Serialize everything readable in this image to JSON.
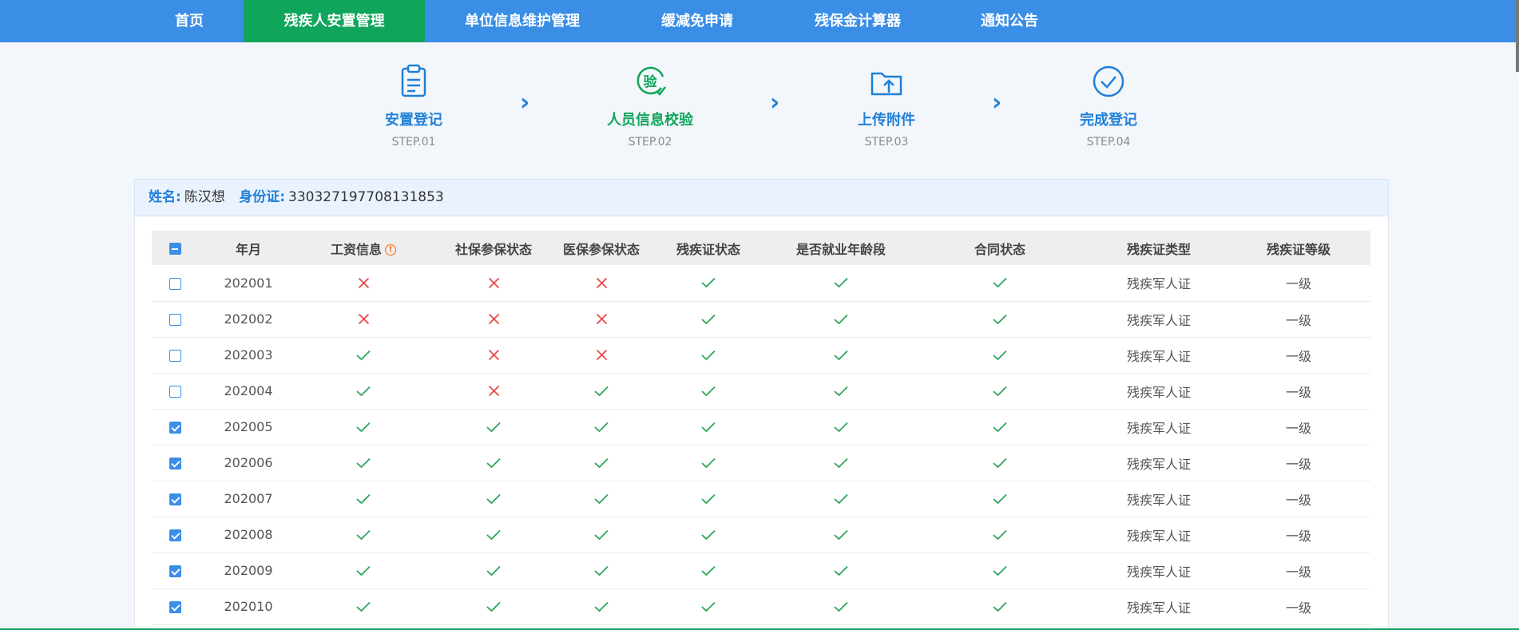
{
  "nav": {
    "items": [
      {
        "label": "首页",
        "active": false
      },
      {
        "label": "残疾人安置管理",
        "active": true
      },
      {
        "label": "单位信息维护管理",
        "active": false
      },
      {
        "label": "缓减免申请",
        "active": false
      },
      {
        "label": "残保金计算器",
        "active": false
      },
      {
        "label": "通知公告",
        "active": false
      }
    ]
  },
  "steps": [
    {
      "label": "安置登记",
      "sub": "STEP.01",
      "icon": "clipboard-icon",
      "current": false
    },
    {
      "label": "人员信息校验",
      "sub": "STEP.02",
      "icon": "verify-icon",
      "current": true
    },
    {
      "label": "上传附件",
      "sub": "STEP.03",
      "icon": "folder-upload-icon",
      "current": false
    },
    {
      "label": "完成登记",
      "sub": "STEP.04",
      "icon": "check-circle-icon",
      "current": false
    }
  ],
  "person": {
    "name_key": "姓名:",
    "name": "陈汉想",
    "id_key": "身份证:",
    "id": "330327197708131853"
  },
  "table": {
    "headers": [
      "年月",
      "工资信息",
      "社保参保状态",
      "医保参保状态",
      "残疾证状态",
      "是否就业年龄段",
      "合同状态",
      "残疾证类型",
      "残疾证等级"
    ],
    "header_warn_icon": "!",
    "colors": {
      "ok": "#2aa55a",
      "fail": "#e84a4a",
      "accent": "#3a8ee6"
    },
    "rows": [
      {
        "checked": false,
        "month": "202001",
        "salary": false,
        "social": false,
        "medical": false,
        "cert": true,
        "age": true,
        "contract": true,
        "type": "残疾军人证",
        "level": "一级"
      },
      {
        "checked": false,
        "month": "202002",
        "salary": false,
        "social": false,
        "medical": false,
        "cert": true,
        "age": true,
        "contract": true,
        "type": "残疾军人证",
        "level": "一级"
      },
      {
        "checked": false,
        "month": "202003",
        "salary": true,
        "social": false,
        "medical": false,
        "cert": true,
        "age": true,
        "contract": true,
        "type": "残疾军人证",
        "level": "一级"
      },
      {
        "checked": false,
        "month": "202004",
        "salary": true,
        "social": false,
        "medical": true,
        "cert": true,
        "age": true,
        "contract": true,
        "type": "残疾军人证",
        "level": "一级"
      },
      {
        "checked": true,
        "month": "202005",
        "salary": true,
        "social": true,
        "medical": true,
        "cert": true,
        "age": true,
        "contract": true,
        "type": "残疾军人证",
        "level": "一级"
      },
      {
        "checked": true,
        "month": "202006",
        "salary": true,
        "social": true,
        "medical": true,
        "cert": true,
        "age": true,
        "contract": true,
        "type": "残疾军人证",
        "level": "一级"
      },
      {
        "checked": true,
        "month": "202007",
        "salary": true,
        "social": true,
        "medical": true,
        "cert": true,
        "age": true,
        "contract": true,
        "type": "残疾军人证",
        "level": "一级"
      },
      {
        "checked": true,
        "month": "202008",
        "salary": true,
        "social": true,
        "medical": true,
        "cert": true,
        "age": true,
        "contract": true,
        "type": "残疾军人证",
        "level": "一级"
      },
      {
        "checked": true,
        "month": "202009",
        "salary": true,
        "social": true,
        "medical": true,
        "cert": true,
        "age": true,
        "contract": true,
        "type": "残疾军人证",
        "level": "一级"
      },
      {
        "checked": true,
        "month": "202010",
        "salary": true,
        "social": true,
        "medical": true,
        "cert": true,
        "age": true,
        "contract": true,
        "type": "残疾军人证",
        "level": "一级"
      }
    ]
  }
}
